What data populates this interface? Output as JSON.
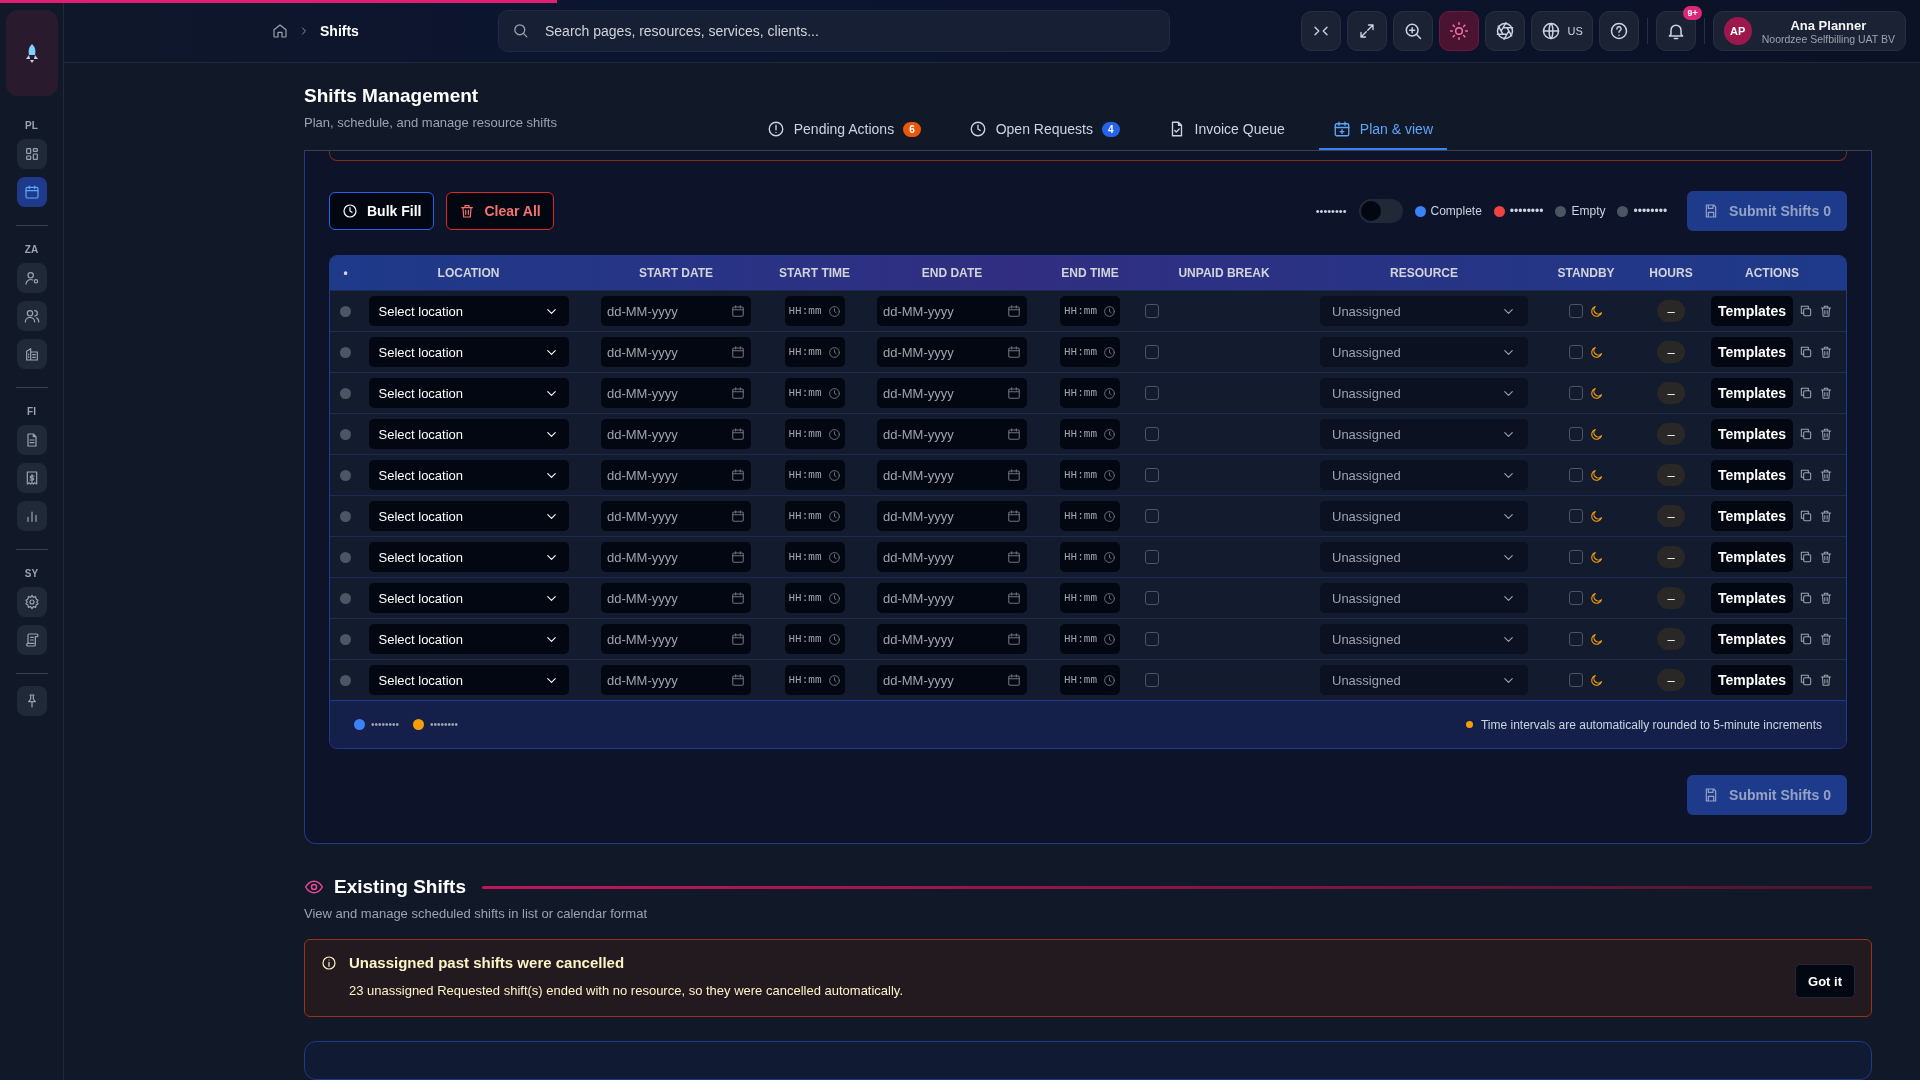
{
  "progress": {
    "level": 0.29
  },
  "sidebar": {
    "groups": [
      {
        "label": "PL",
        "items": [
          {
            "selected": false
          },
          {
            "selected": true
          }
        ]
      },
      {
        "label": "ZA",
        "items": [
          {
            "selected": false
          },
          {
            "selected": false
          },
          {
            "selected": false
          }
        ]
      },
      {
        "label": "FI",
        "items": [
          {
            "selected": false
          },
          {
            "selected": false
          },
          {
            "selected": false
          }
        ]
      },
      {
        "label": "SY",
        "items": [
          {
            "selected": false
          },
          {
            "selected": false
          }
        ]
      }
    ]
  },
  "topbar": {
    "breadcrumb": "Shifts",
    "search": {
      "placeholder": "Search pages, resources, services, clients..."
    },
    "language": "US",
    "notifications": "9+",
    "user": {
      "initials": "AP",
      "name": "Ana Planner",
      "org": "Noordzee Selfbilling UAT BV"
    }
  },
  "page": {
    "title": "Shifts Management",
    "subtitle": "Plan, schedule, and manage resource shifts"
  },
  "tabs": [
    {
      "label": "Pending Actions",
      "badge": "6",
      "color": "#ea580c",
      "selected": false
    },
    {
      "label": "Open Requests",
      "badge": "4",
      "color": "#2563eb",
      "selected": false
    },
    {
      "label": "Invoice Queue",
      "selected": false
    },
    {
      "label": "Plan & view",
      "selected": true
    }
  ],
  "toolbar": {
    "bulk_fill": "Bulk Fill",
    "clear_all": "Clear All",
    "toggle": {
      "label": "••••••••",
      "on": false
    },
    "legend": [
      {
        "label": "Complete",
        "color": "#3b82f6"
      },
      {
        "label": "••••••••",
        "color": "#ef4444"
      },
      {
        "label": "Empty",
        "color": "#4b5563"
      },
      {
        "label": "••••••••",
        "color": "#4b5563"
      }
    ],
    "submit": "Submit Shifts 0"
  },
  "table": {
    "columns": [
      "•",
      "LOCATION",
      "START DATE",
      "START TIME",
      "END DATE",
      "END TIME",
      "UNPAID BREAK",
      "RESOURCE",
      "STANDBY",
      "HOURS",
      "ACTIONS"
    ],
    "rows": [
      {
        "location": "Select location",
        "start_date": "dd-MM-yyyy",
        "start_time": "HH:mm",
        "end_date": "dd-MM-yyyy",
        "end_time": "HH:mm",
        "unpaid_break": false,
        "resource": "Unassigned",
        "standby": false,
        "hours": "–",
        "action": "Templates"
      },
      {
        "location": "Select location",
        "start_date": "dd-MM-yyyy",
        "start_time": "HH:mm",
        "end_date": "dd-MM-yyyy",
        "end_time": "HH:mm",
        "unpaid_break": false,
        "resource": "Unassigned",
        "standby": false,
        "hours": "–",
        "action": "Templates"
      },
      {
        "location": "Select location",
        "start_date": "dd-MM-yyyy",
        "start_time": "HH:mm",
        "end_date": "dd-MM-yyyy",
        "end_time": "HH:mm",
        "unpaid_break": false,
        "resource": "Unassigned",
        "standby": false,
        "hours": "–",
        "action": "Templates"
      },
      {
        "location": "Select location",
        "start_date": "dd-MM-yyyy",
        "start_time": "HH:mm",
        "end_date": "dd-MM-yyyy",
        "end_time": "HH:mm",
        "unpaid_break": false,
        "resource": "Unassigned",
        "standby": false,
        "hours": "–",
        "action": "Templates"
      },
      {
        "location": "Select location",
        "start_date": "dd-MM-yyyy",
        "start_time": "HH:mm",
        "end_date": "dd-MM-yyyy",
        "end_time": "HH:mm",
        "unpaid_break": false,
        "resource": "Unassigned",
        "standby": false,
        "hours": "–",
        "action": "Templates"
      },
      {
        "location": "Select location",
        "start_date": "dd-MM-yyyy",
        "start_time": "HH:mm",
        "end_date": "dd-MM-yyyy",
        "end_time": "HH:mm",
        "unpaid_break": false,
        "resource": "Unassigned",
        "standby": false,
        "hours": "–",
        "action": "Templates"
      },
      {
        "location": "Select location",
        "start_date": "dd-MM-yyyy",
        "start_time": "HH:mm",
        "end_date": "dd-MM-yyyy",
        "end_time": "HH:mm",
        "unpaid_break": false,
        "resource": "Unassigned",
        "standby": false,
        "hours": "–",
        "action": "Templates"
      },
      {
        "location": "Select location",
        "start_date": "dd-MM-yyyy",
        "start_time": "HH:mm",
        "end_date": "dd-MM-yyyy",
        "end_time": "HH:mm",
        "unpaid_break": false,
        "resource": "Unassigned",
        "standby": false,
        "hours": "–",
        "action": "Templates"
      },
      {
        "location": "Select location",
        "start_date": "dd-MM-yyyy",
        "start_time": "HH:mm",
        "end_date": "dd-MM-yyyy",
        "end_time": "HH:mm",
        "unpaid_break": false,
        "resource": "Unassigned",
        "standby": false,
        "hours": "–",
        "action": "Templates"
      },
      {
        "location": "Select location",
        "start_date": "dd-MM-yyyy",
        "start_time": "HH:mm",
        "end_date": "dd-MM-yyyy",
        "end_time": "HH:mm",
        "unpaid_break": false,
        "resource": "Unassigned",
        "standby": false,
        "hours": "–",
        "action": "Templates"
      }
    ],
    "footer_legend": [
      {
        "label": "••••••••",
        "color": "#3b82f6"
      },
      {
        "label": "••••••••",
        "color": "#f59e0b"
      }
    ],
    "note": "Time intervals are automatically rounded to 5-minute increments"
  },
  "bottom_submit": "Submit Shifts 0",
  "existing": {
    "title": "Existing Shifts",
    "subtitle": "View and manage scheduled shifts in list or calendar format",
    "alert": {
      "title": "Unassigned past shifts were cancelled",
      "message": "23 unassigned Requested shift(s) ended with no resource, so they were cancelled automatically.",
      "button": "Got it"
    }
  }
}
